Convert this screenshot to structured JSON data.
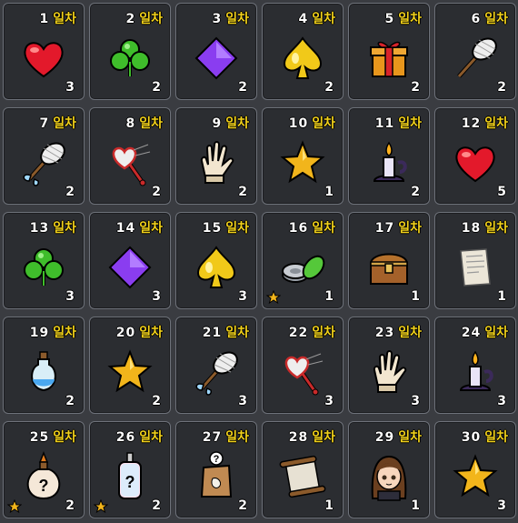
{
  "unit_label": "일차",
  "rewards": [
    {
      "day": "1",
      "item": "heart-icon",
      "qty": "3"
    },
    {
      "day": "2",
      "item": "clover-icon",
      "qty": "2"
    },
    {
      "day": "3",
      "item": "diamond-icon",
      "qty": "2"
    },
    {
      "day": "4",
      "item": "spade-icon",
      "qty": "2"
    },
    {
      "day": "5",
      "item": "gift-box-icon",
      "qty": "2"
    },
    {
      "day": "6",
      "item": "bug-net-icon",
      "qty": "2"
    },
    {
      "day": "7",
      "item": "winged-bug-net-icon",
      "qty": "2"
    },
    {
      "day": "8",
      "item": "heart-bug-net-icon",
      "qty": "2"
    },
    {
      "day": "9",
      "item": "glove-icon",
      "qty": "2"
    },
    {
      "day": "10",
      "item": "star-icon",
      "qty": "1"
    },
    {
      "day": "11",
      "item": "candle-icon",
      "qty": "2"
    },
    {
      "day": "12",
      "item": "heart-icon",
      "qty": "5"
    },
    {
      "day": "13",
      "item": "clover-icon",
      "qty": "3"
    },
    {
      "day": "14",
      "item": "diamond-icon",
      "qty": "3"
    },
    {
      "day": "15",
      "item": "spade-icon",
      "qty": "3"
    },
    {
      "day": "16",
      "item": "gear-disc-icon",
      "qty": "1",
      "badge": "small-star-icon"
    },
    {
      "day": "17",
      "item": "treasure-chest-icon",
      "qty": "1"
    },
    {
      "day": "18",
      "item": "paper-letter-icon",
      "qty": "1"
    },
    {
      "day": "19",
      "item": "potion-icon",
      "qty": "2"
    },
    {
      "day": "20",
      "item": "star-icon",
      "qty": "2"
    },
    {
      "day": "21",
      "item": "winged-bug-net-icon",
      "qty": "3"
    },
    {
      "day": "22",
      "item": "heart-bug-net-icon",
      "qty": "3"
    },
    {
      "day": "23",
      "item": "glove-icon",
      "qty": "3"
    },
    {
      "day": "24",
      "item": "candle-icon",
      "qty": "3"
    },
    {
      "day": "25",
      "item": "mystery-flask-icon",
      "qty": "2",
      "badge": "small-star-icon"
    },
    {
      "day": "26",
      "item": "mystery-bottle-icon",
      "qty": "2",
      "badge": "small-star-icon"
    },
    {
      "day": "27",
      "item": "mystery-seed-bag-icon",
      "qty": "2"
    },
    {
      "day": "28",
      "item": "scroll-icon",
      "qty": "1"
    },
    {
      "day": "29",
      "item": "character-portrait-icon",
      "qty": "1"
    },
    {
      "day": "30",
      "item": "star-icon",
      "qty": "3"
    }
  ],
  "colors": {
    "background": "#3a3c41",
    "cell": "#2b2d31",
    "cell_border": "#6e727a",
    "day_unit": "#f2d21b"
  }
}
